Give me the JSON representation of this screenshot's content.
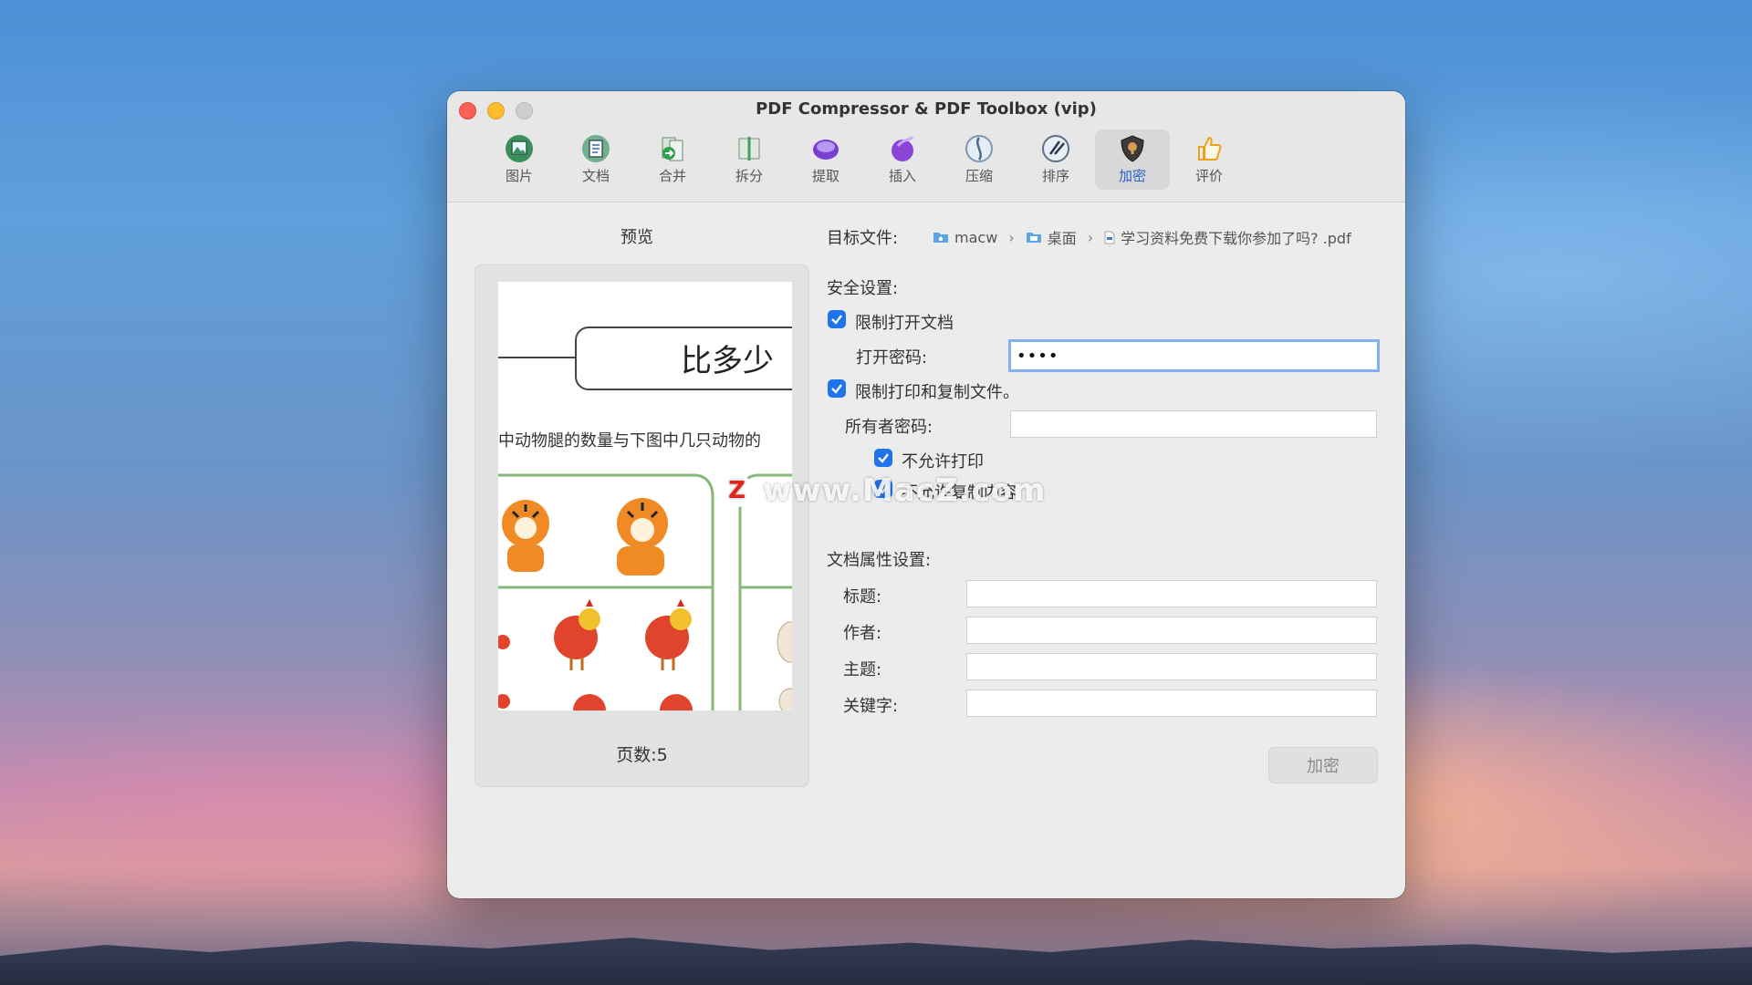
{
  "window": {
    "title": "PDF Compressor & PDF Toolbox (vip)"
  },
  "toolbar": {
    "items": [
      {
        "label": "图片",
        "icon": "image-icon"
      },
      {
        "label": "文档",
        "icon": "document-icon"
      },
      {
        "label": "合并",
        "icon": "merge-icon"
      },
      {
        "label": "拆分",
        "icon": "split-icon"
      },
      {
        "label": "提取",
        "icon": "extract-icon"
      },
      {
        "label": "插入",
        "icon": "insert-icon"
      },
      {
        "label": "压缩",
        "icon": "compress-icon"
      },
      {
        "label": "排序",
        "icon": "sort-icon"
      },
      {
        "label": "加密",
        "icon": "encrypt-icon"
      },
      {
        "label": "评价",
        "icon": "thumbs-up-icon"
      }
    ],
    "active": "加密"
  },
  "preview": {
    "heading": "预览",
    "page_count": "页数:5",
    "page_title": "比多少",
    "page_text": "中动物腿的数量与下图中几只动物的"
  },
  "target": {
    "label": "目标文件:",
    "path": [
      "macw",
      "桌面",
      "学习资料免费下载你参加了吗? .pdf"
    ]
  },
  "security": {
    "heading": "安全设置:",
    "restrict_open_label": "限制打开文档",
    "restrict_open_checked": true,
    "open_password_label": "打开密码:",
    "open_password_value": "••••",
    "restrict_print_copy_label": "限制打印和复制文件。",
    "restrict_print_copy_checked": true,
    "owner_password_label": "所有者密码:",
    "owner_password_value": "",
    "no_print_label": "不允许打印",
    "no_print_checked": true,
    "no_copy_label": "不允许复制内容",
    "no_copy_checked": true
  },
  "properties": {
    "heading": "文档属性设置:",
    "title_label": "标题:",
    "author_label": "作者:",
    "subject_label": "主题:",
    "keywords_label": "关键字:"
  },
  "actions": {
    "encrypt_label": "加密"
  },
  "watermark": {
    "badge": "Z",
    "text": "www.MacZ.com"
  },
  "colors": {
    "accent": "#1f74ea",
    "focus_ring": "#85afee",
    "window_bg": "#ececec"
  }
}
